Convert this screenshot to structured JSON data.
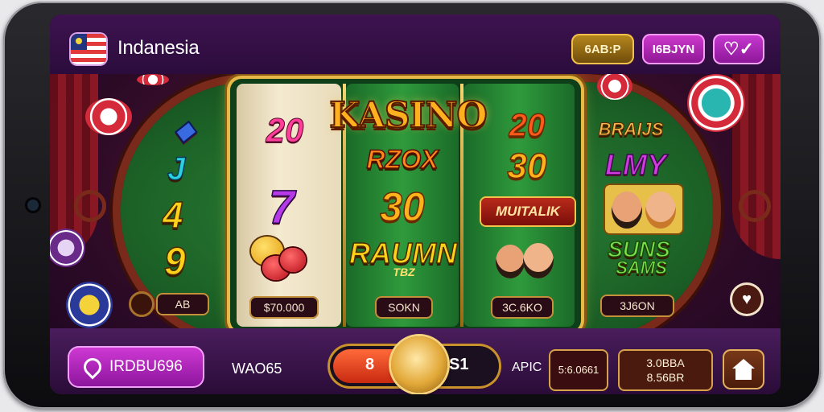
{
  "topbar": {
    "region_name": "Indanesia",
    "balance_label": "6AB:P",
    "bonus_label": "I6BJYN",
    "vip_icon": "heart-check-icon"
  },
  "title": "KASINO",
  "reels": {
    "left_column": [
      "J",
      "4",
      "9"
    ],
    "reel1": [
      "20",
      "7"
    ],
    "reel2": [
      "RZOX",
      "30",
      "RAUMN",
      "TBZ"
    ],
    "reel3": [
      "20",
      "30",
      "MUITALIK"
    ],
    "right_column": [
      "BRAIJS",
      "LMY",
      "SUNS",
      "SAMS"
    ]
  },
  "plates": {
    "left": "AB",
    "reel1": "$70.000",
    "reel2": "SOKN",
    "reel3": "3C.6KO",
    "right": "3J6ON"
  },
  "bottombar": {
    "region_button": "IRDBU696",
    "bet_label": "WAO65",
    "slider_left": "8",
    "slider_right": "S1",
    "spin_label": "APIC",
    "credit_value": "5:6.0661",
    "win_line1": "3.0BBA",
    "win_line2": "8.56BR",
    "home_icon": "home-icon"
  },
  "colors": {
    "accent_pink": "#d13ad0",
    "accent_gold": "#e6b948",
    "table_green": "#2f8a3a"
  }
}
